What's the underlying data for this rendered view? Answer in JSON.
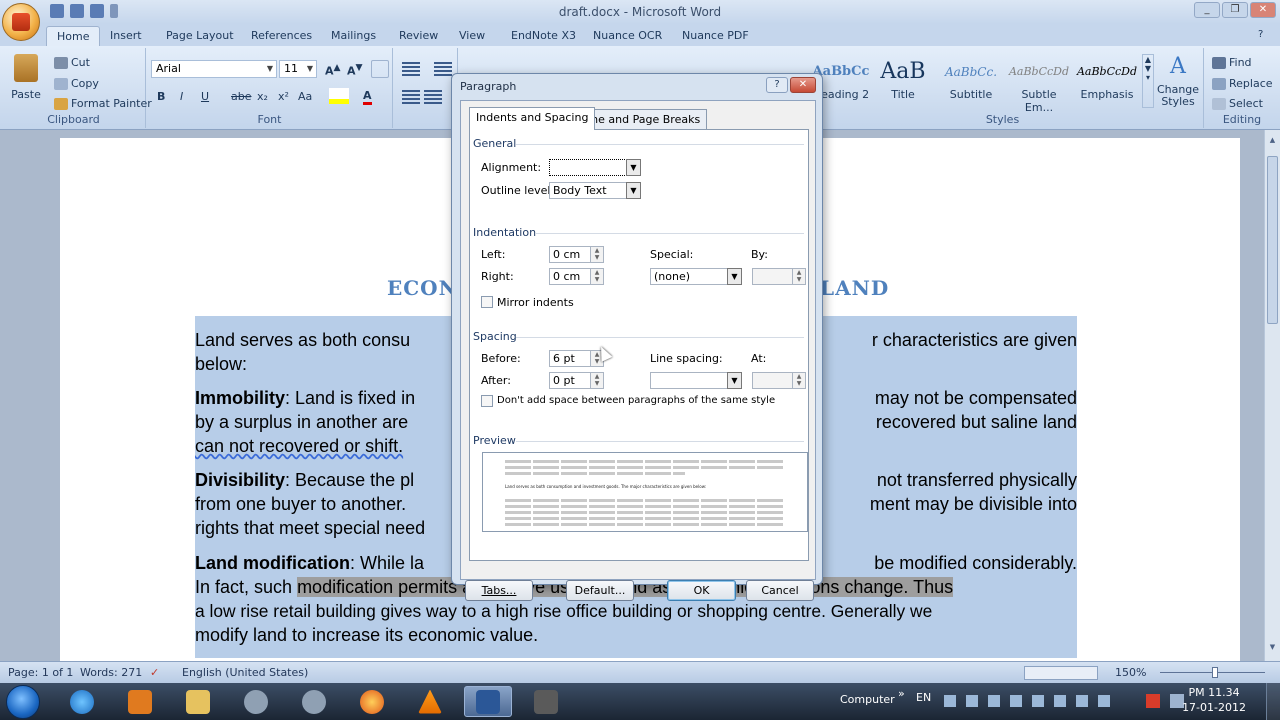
{
  "window": {
    "title": "draft.docx - Microsoft Word",
    "controls": [
      "_",
      "❐",
      "✕"
    ]
  },
  "tabs": [
    "Home",
    "Insert",
    "Page Layout",
    "References",
    "Mailings",
    "Review",
    "View",
    "EndNote X3",
    "Nuance OCR",
    "Nuance PDF"
  ],
  "clipboard": {
    "paste": "Paste",
    "cut": "Cut",
    "copy": "Copy",
    "format_painter": "Format Painter",
    "group": "Clipboard"
  },
  "font": {
    "name": "Arial",
    "size": "11",
    "group": "Font",
    "buttons": [
      "B",
      "I",
      "U",
      "abe",
      "x₂",
      "x²",
      "Aa",
      "A"
    ]
  },
  "paragraph_group": "Paragraph",
  "styles": {
    "items": [
      {
        "preview": "AaBbCc",
        "name": "Heading 2"
      },
      {
        "preview": "AaB",
        "name": "Title"
      },
      {
        "preview": "AaBbCc.",
        "name": "Subtitle"
      },
      {
        "preview": "AaBbCcDd",
        "name": "Subtle Em..."
      },
      {
        "preview": "AaBbCcDd",
        "name": "Emphasis"
      }
    ],
    "change_styles": "Change Styles",
    "group": "Styles"
  },
  "editing": {
    "find": "Find",
    "replace": "Replace",
    "select": "Select",
    "group": "Editing"
  },
  "document": {
    "heading_left": "ECON",
    "heading_right": "LAND",
    "p1": {
      "text1": "Land serves as both consu",
      "text2": "r characteristics are given",
      "text3": "below:"
    },
    "p2": {
      "bold": "Immobility",
      "text1": ": Land is fixed in",
      "text2": "may not be compensated",
      "line2a": "by a surplus in another are",
      "line2b": "recovered but saline land",
      "line3": "can not recovered or shift."
    },
    "p3": {
      "bold": "Divisibility",
      "text1": ": Because the pl",
      "text2": "not transferred physically",
      "line2a": "from one buyer to another.",
      "line2b": "ment may be divisible into",
      "line3": "rights that meet special need"
    },
    "p4": {
      "bold": "Land modification",
      "text1": ": While la",
      "text2": "be modified considerably.",
      "line2a": "In fact, such ",
      "line2b": "modification permits alternative uses of land as economic conditions change. Thus",
      "line3": "a low rise retail building gives way to a high rise office building or shopping centre. Generally we",
      "line4": "modify land to increase its economic value."
    }
  },
  "dialog": {
    "title": "Paragraph",
    "help": "?",
    "close": "✕",
    "tabs": [
      "Indents and Spacing",
      "Line and Page Breaks"
    ],
    "general": {
      "section": "General",
      "alignment_label": "Alignment:",
      "alignment_value": "",
      "outline_label": "Outline level:",
      "outline_value": "Body Text"
    },
    "indentation": {
      "section": "Indentation",
      "left_label": "Left:",
      "left_value": "0 cm",
      "right_label": "Right:",
      "right_value": "0 cm",
      "special_label": "Special:",
      "special_value": "(none)",
      "by_label": "By:",
      "by_value": "",
      "mirror": "Mirror indents"
    },
    "spacing": {
      "section": "Spacing",
      "before_label": "Before:",
      "before_value": "6 pt",
      "after_label": "After:",
      "after_value": "0 pt",
      "line_spacing_label": "Line spacing:",
      "line_spacing_value": "",
      "at_label": "At:",
      "at_value": "",
      "dont_add": "Don't add space between paragraphs of the same style"
    },
    "preview": {
      "section": "Preview",
      "sample": "Land serves as both consumption and investment goods. The major characteristics are given below:"
    },
    "buttons": {
      "tabs": "Tabs...",
      "default": "Default...",
      "ok": "OK",
      "cancel": "Cancel"
    }
  },
  "status": {
    "page": "Page: 1 of 1",
    "words": "Words: 271",
    "language": "English (United States)",
    "zoom": "150%"
  },
  "taskbar": {
    "computer": "Computer",
    "lang": "EN",
    "time": "PM 11.34",
    "date": "17-01-2012"
  }
}
